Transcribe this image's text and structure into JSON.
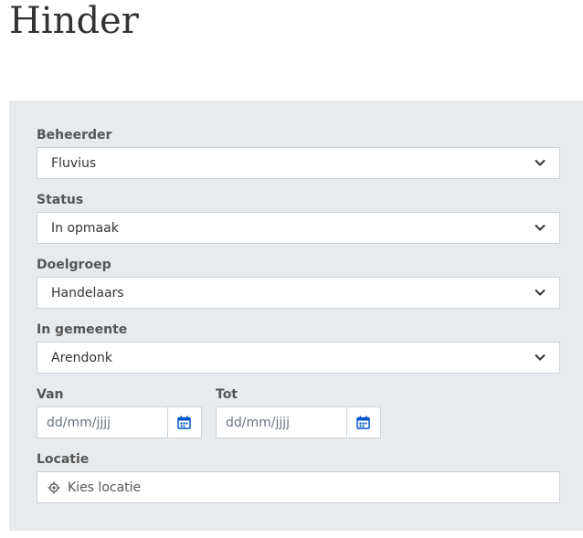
{
  "page": {
    "title": "Hinder"
  },
  "filters": {
    "beheerder": {
      "label": "Beheerder",
      "value": "Fluvius"
    },
    "status": {
      "label": "Status",
      "value": "In opmaak"
    },
    "doelgroep": {
      "label": "Doelgroep",
      "value": "Handelaars"
    },
    "gemeente": {
      "label": "In gemeente",
      "value": "Arendonk"
    },
    "van": {
      "label": "Van",
      "placeholder": "dd/mm/jjjj"
    },
    "tot": {
      "label": "Tot",
      "placeholder": "dd/mm/jjjj"
    },
    "locatie": {
      "label": "Locatie",
      "placeholder": "Kies locatie"
    }
  },
  "icons": {
    "chevron": "chevron-down-icon",
    "calendar": "calendar-icon",
    "location": "location-target-icon"
  },
  "colors": {
    "panel_bg": "#e8ebee",
    "border": "#cbd2da",
    "accent": "#0055cc",
    "text": "#333332"
  }
}
